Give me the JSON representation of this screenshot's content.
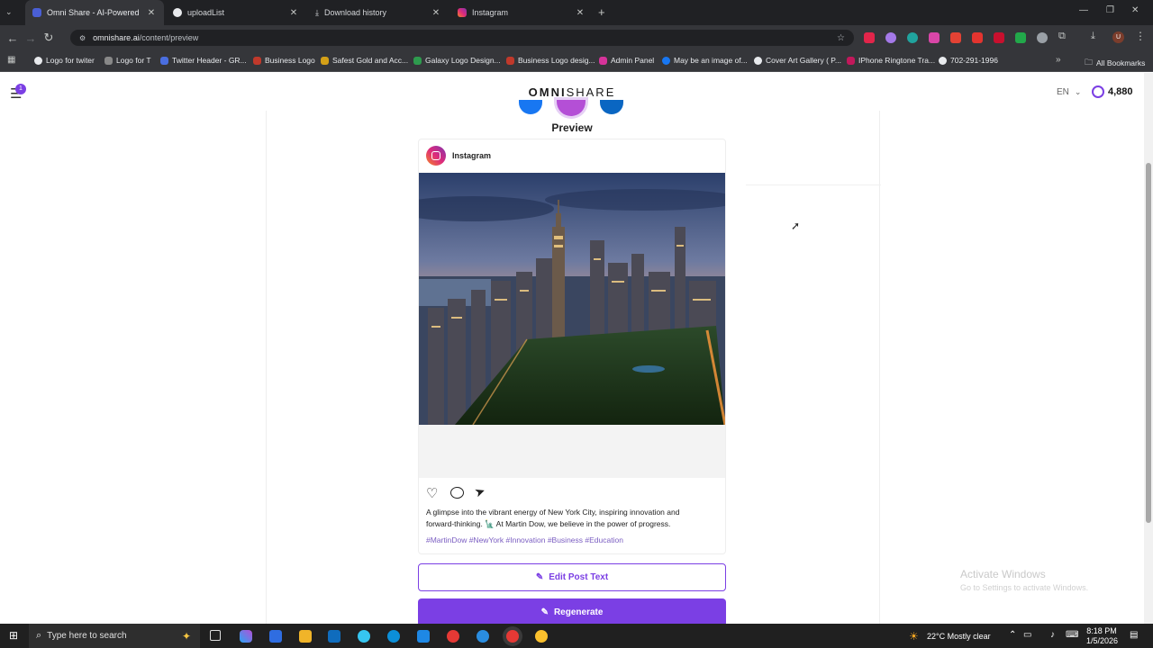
{
  "browser": {
    "tabs": [
      {
        "title": "Omni Share - AI-Powered Social",
        "active": true,
        "color": "#4a5fd6"
      },
      {
        "title": "uploadList",
        "active": false,
        "color": "#e8eaed"
      },
      {
        "title": "Download history",
        "active": false,
        "color": "#e8eaed"
      },
      {
        "title": "Instagram",
        "active": false,
        "color": "#e1306c"
      }
    ],
    "url_domain": "omnishare.ai",
    "url_path": "/content/preview",
    "bookmarks": [
      "Logo for twiter",
      "Logo for T",
      "Twitter Header - GR...",
      "Business Logo",
      "Safest Gold and Acc...",
      "Galaxy Logo Design...",
      "Business Logo desig...",
      "Admin Panel",
      "May be an image of...",
      "Cover Art Gallery ( P...",
      "IPhone Ringtone Tra...",
      "702-291-1996"
    ],
    "all_bookmarks": "All Bookmarks"
  },
  "app": {
    "logo_bold": "OMNI",
    "logo_rest": "SHARE",
    "notification_count": "1",
    "language": "EN",
    "credits": "4,880",
    "preview_title": "Preview",
    "platform_name": "Instagram",
    "caption_line1": "A glimpse into the vibrant energy of New York City, inspiring innovation and",
    "caption_line2": "forward-thinking. 🗽 At Martin Dow, we believe in the power of progress.",
    "hashtags": "#MartinDow #NewYork #Innovation #Business #Education",
    "edit_button": "Edit Post Text",
    "regenerate_button": "Regenerate",
    "accent": "#7b3fe4"
  },
  "windows": {
    "watermark_title": "Activate Windows",
    "watermark_sub": "Go to Settings to activate Windows.",
    "search_placeholder": "Type here to search",
    "weather": "22°C  Mostly clear",
    "time": "8:18 PM",
    "date": "1/5/2026"
  }
}
